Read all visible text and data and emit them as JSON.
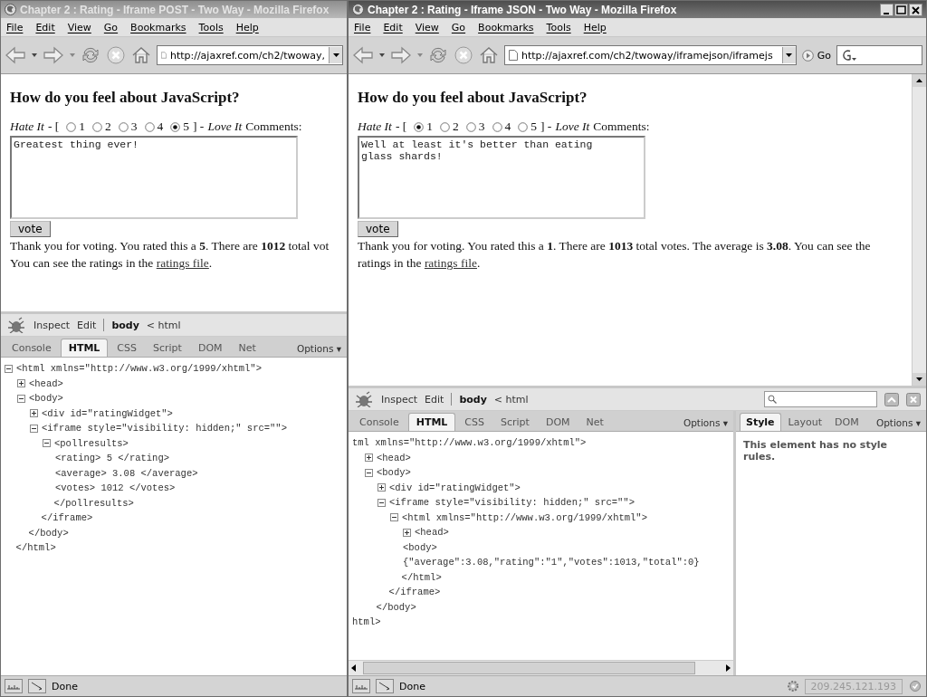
{
  "windows": [
    {
      "title": "Chapter 2 : Rating - Iframe POST - Two Way - Mozilla Firefox",
      "active": false,
      "window_buttons": false,
      "menu": [
        "File",
        "Edit",
        "View",
        "Go",
        "Bookmarks",
        "Tools",
        "Help"
      ],
      "url": "http://ajaxref.com/ch2/twoway,",
      "search_box": false,
      "page_scrollbar": false,
      "heading": "How do you feel about JavaScript?",
      "hate": "Hate It",
      "open": "- [",
      "options": [
        {
          "label": "1",
          "selected": false
        },
        {
          "label": "2",
          "selected": false
        },
        {
          "label": "3",
          "selected": false
        },
        {
          "label": "4",
          "selected": false
        },
        {
          "label": "5",
          "selected": true
        }
      ],
      "close": "] -",
      "love": "Love It",
      "comments": "Comments:",
      "comment_text": "Greatest thing ever!",
      "vote": "vote",
      "result_lines": [
        "Thank you for voting. You rated this a **5**. There are **1012** total vot",
        "You can see the ratings in the "
      ],
      "link": "ratings file",
      "after": ".",
      "firebug": {
        "inspect": "Inspect",
        "edit": "Edit",
        "crumbs": [
          "body",
          "< html"
        ],
        "tabs": [
          {
            "label": "Console",
            "selected": false
          },
          {
            "label": "HTML",
            "selected": true
          },
          {
            "label": "CSS",
            "selected": false
          },
          {
            "label": "Script",
            "selected": false
          },
          {
            "label": "DOM",
            "selected": false
          },
          {
            "label": "Net",
            "selected": false
          }
        ],
        "options": "Options ▾",
        "search": false,
        "tree": [
          {
            "text": "<html xmlns=\"http://www.w3.org/1999/xhtml\">",
            "expanded": true,
            "close": "</html>",
            "children": [
              {
                "text": "<head>",
                "expanded": false
              },
              {
                "text": "<body>",
                "expanded": true,
                "close": "</body>",
                "children": [
                  {
                    "text": "<div id=\"ratingWidget\">",
                    "expanded": false
                  },
                  {
                    "text": "<iframe style=\"visibility: hidden;\" src=\"\">",
                    "expanded": true,
                    "close": "</iframe>",
                    "children": [
                      {
                        "text": "<pollresults>",
                        "expanded": true,
                        "close": "</pollresults>",
                        "children": [
                          {
                            "text": "<rating> 5 </rating>"
                          },
                          {
                            "text": "<average> 3.08 </average>"
                          },
                          {
                            "text": "<votes> 1012 </votes>"
                          }
                        ]
                      }
                    ]
                  }
                ]
              }
            ]
          }
        ]
      },
      "status": "Done"
    },
    {
      "title": "Chapter 2 : Rating - Iframe JSON - Two Way - Mozilla Firefox",
      "active": true,
      "window_buttons": true,
      "menu": [
        "File",
        "Edit",
        "View",
        "Go",
        "Bookmarks",
        "Tools",
        "Help"
      ],
      "url": "http://ajaxref.com/ch2/twoway/iframejson/iframejs",
      "go_label": "Go",
      "search_box": true,
      "page_scrollbar": true,
      "heading": "How do you feel about JavaScript?",
      "hate": "Hate It",
      "open": "- [",
      "options": [
        {
          "label": "1",
          "selected": true
        },
        {
          "label": "2",
          "selected": false
        },
        {
          "label": "3",
          "selected": false
        },
        {
          "label": "4",
          "selected": false
        },
        {
          "label": "5",
          "selected": false
        }
      ],
      "close": "] -",
      "love": "Love It",
      "comments": "Comments:",
      "comment_text": "Well at least it's better than eating\nglass shards!",
      "vote": "vote",
      "result_lines": [
        "Thank you for voting. You rated this a **1**. There are **1013** total votes. The average is **3.08**. You can see the ratings in the "
      ],
      "link": "ratings file",
      "after": ".",
      "firebug": {
        "inspect": "Inspect",
        "edit": "Edit",
        "crumbs": [
          "body",
          "< html"
        ],
        "tabs": [
          {
            "label": "Console",
            "selected": false
          },
          {
            "label": "HTML",
            "selected": true
          },
          {
            "label": "CSS",
            "selected": false
          },
          {
            "label": "Script",
            "selected": false
          },
          {
            "label": "DOM",
            "selected": false
          },
          {
            "label": "Net",
            "selected": false
          }
        ],
        "options": "Options ▾",
        "search": true,
        "tree": [
          {
            "text": "tml xmlns=\"http://www.w3.org/1999/xhtml\">",
            "close": "html>",
            "children": [
              {
                "text": "<head>",
                "expanded": false
              },
              {
                "text": "<body>",
                "expanded": true,
                "close": "</body>",
                "children": [
                  {
                    "text": "<div id=\"ratingWidget\">",
                    "expanded": false
                  },
                  {
                    "text": "<iframe style=\"visibility: hidden;\" src=\"\">",
                    "expanded": true,
                    "close": "</iframe>",
                    "children": [
                      {
                        "text": "<html xmlns=\"http://www.w3.org/1999/xhtml\">",
                        "expanded": true,
                        "close": "</html>",
                        "children": [
                          {
                            "text": "<head>",
                            "expanded": false
                          },
                          {
                            "text": "<body>"
                          },
                          {
                            "text": "{\"average\":3.08,\"rating\":\"1\",\"votes\":1013,\"total\":0}"
                          }
                        ]
                      }
                    ]
                  }
                ]
              }
            ]
          }
        ],
        "side": {
          "tabs": [
            {
              "label": "Style",
              "selected": true
            },
            {
              "label": "Layout",
              "selected": false
            },
            {
              "label": "DOM",
              "selected": false
            }
          ],
          "options": "Options ▾",
          "message": "This element has no style rules."
        }
      },
      "status": "Done",
      "ip": "209.245.121.193"
    }
  ]
}
